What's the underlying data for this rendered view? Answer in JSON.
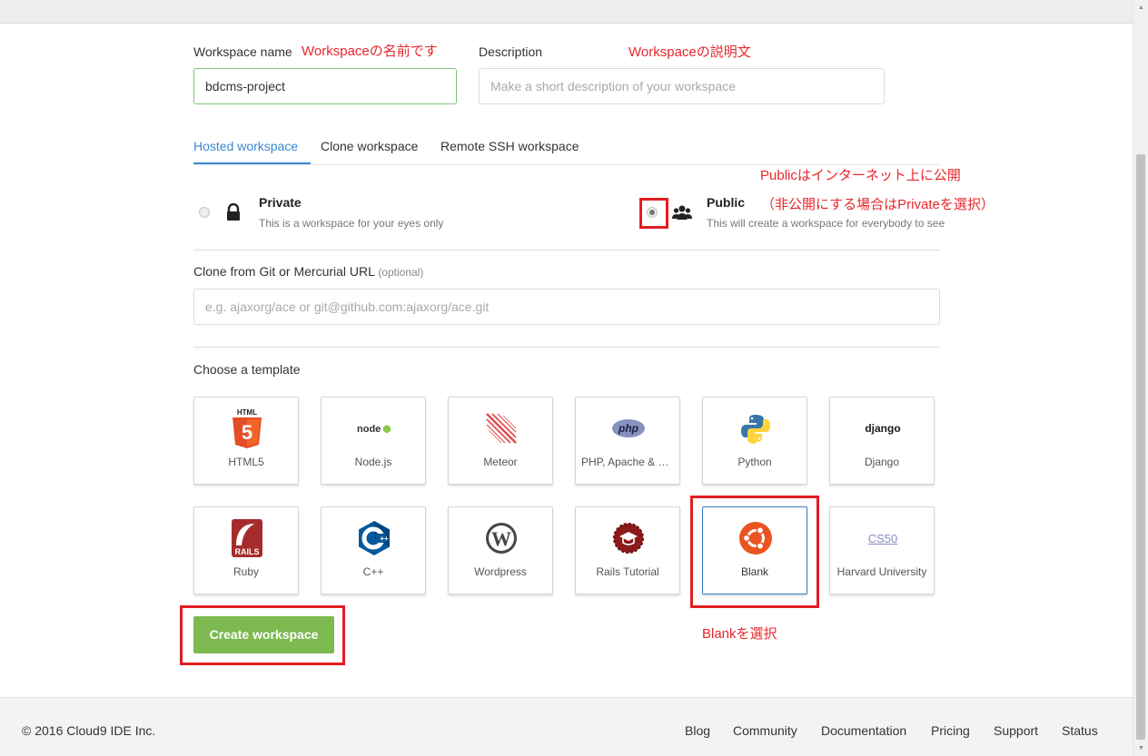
{
  "form": {
    "workspace_name_label": "Workspace name",
    "workspace_name_value": "bdcms-project",
    "description_label": "Description",
    "description_placeholder": "Make a short description of your workspace"
  },
  "annotations": {
    "name_note": "Workspaceの名前です",
    "description_note": "Workspaceの説明文",
    "public_note_1": "Publicはインターネット上に公開",
    "public_note_2": "（非公開にする場合はPrivateを選択）",
    "blank_note": "Blankを選択"
  },
  "tabs": [
    {
      "label": "Hosted workspace",
      "active": true
    },
    {
      "label": "Clone workspace",
      "active": false
    },
    {
      "label": "Remote SSH workspace",
      "active": false
    }
  ],
  "visibility": {
    "private_title": "Private",
    "private_subtitle": "This is a workspace for your eyes only",
    "public_title": "Public",
    "public_subtitle": "This will create a workspace for everybody to see",
    "selected": "public"
  },
  "clone": {
    "label": "Clone from Git or Mercurial URL",
    "optional": "(optional)",
    "placeholder": "e.g. ajaxorg/ace or git@github.com:ajaxorg/ace.git"
  },
  "templates": {
    "label": "Choose a template",
    "items": [
      {
        "name": "HTML5",
        "icon": "html5-icon"
      },
      {
        "name": "Node.js",
        "icon": "nodejs-icon",
        "icon_text": "node"
      },
      {
        "name": "Meteor",
        "icon": "meteor-icon"
      },
      {
        "name": "PHP, Apache & MySQL",
        "icon": "php-icon",
        "icon_text": "php"
      },
      {
        "name": "Python",
        "icon": "python-icon"
      },
      {
        "name": "Django",
        "icon": "django-icon",
        "icon_text": "django"
      },
      {
        "name": "Ruby",
        "icon": "ruby-rails-icon"
      },
      {
        "name": "C++",
        "icon": "cpp-icon"
      },
      {
        "name": "Wordpress",
        "icon": "wordpress-icon"
      },
      {
        "name": "Rails Tutorial",
        "icon": "rails-tutorial-icon"
      },
      {
        "name": "Blank",
        "icon": "ubuntu-icon",
        "selected": true
      },
      {
        "name": "Harvard University",
        "icon": "cs50-icon",
        "icon_text": "CS50"
      }
    ]
  },
  "create_button": "Create workspace",
  "footer": {
    "copyright": "© 2016 Cloud9 IDE Inc.",
    "links": [
      "Blog",
      "Community",
      "Documentation",
      "Pricing",
      "Support",
      "Status"
    ]
  },
  "colors": {
    "accent_blue": "#3a8ad3",
    "create_green": "#7cb94f",
    "annotation_red": "#e8262b"
  }
}
